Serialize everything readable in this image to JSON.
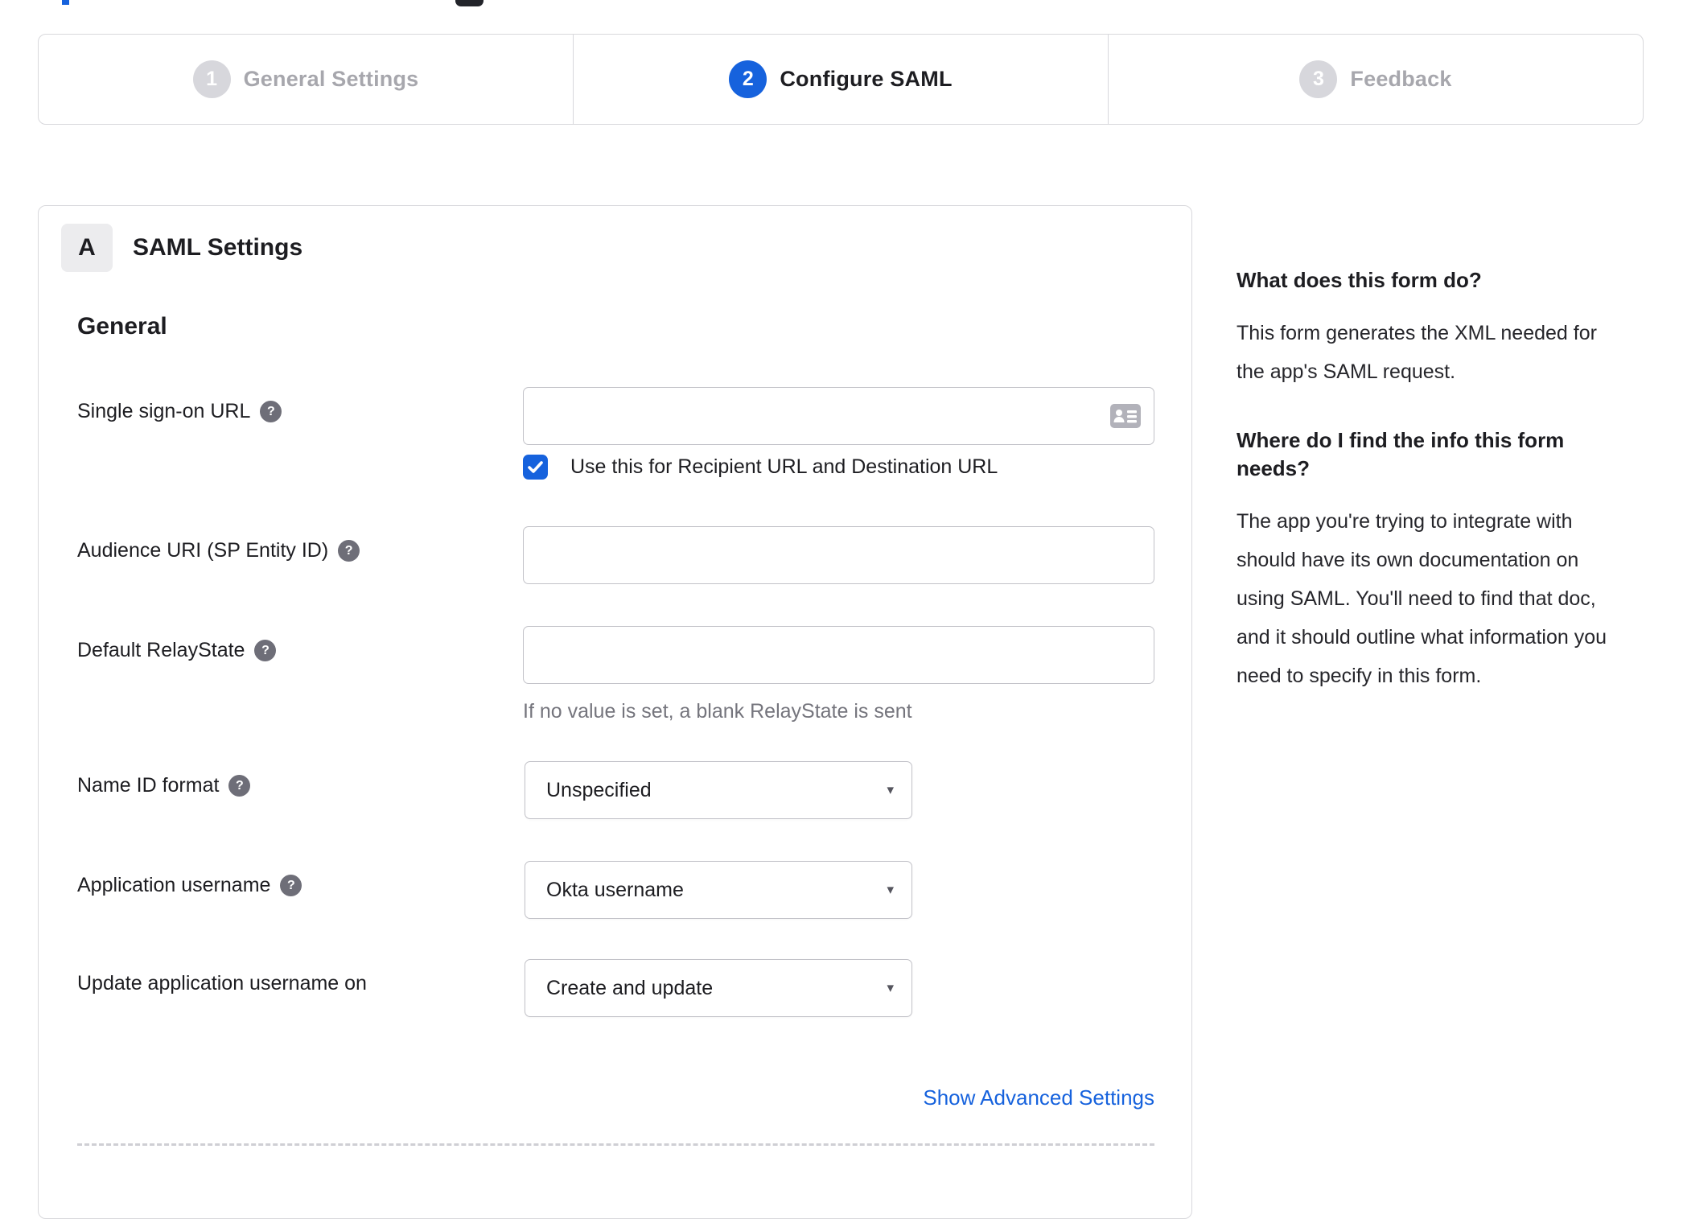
{
  "stepper": {
    "steps": [
      {
        "number": "1",
        "label": "General Settings",
        "state": "inactive"
      },
      {
        "number": "2",
        "label": "Configure SAML",
        "state": "active"
      },
      {
        "number": "3",
        "label": "Feedback",
        "state": "inactive"
      }
    ]
  },
  "form": {
    "section_badge": "A",
    "section_title": "SAML Settings",
    "group_heading": "General",
    "fields": {
      "sso_url": {
        "label": "Single sign-on URL",
        "value": "",
        "checkbox_label": "Use this for Recipient URL and Destination URL",
        "checkbox_checked": "true"
      },
      "audience_uri": {
        "label": "Audience URI (SP Entity ID)",
        "value": ""
      },
      "default_relaystate": {
        "label": "Default RelayState",
        "value": "",
        "hint": "If no value is set, a blank RelayState is sent"
      },
      "name_id_format": {
        "label": "Name ID format",
        "value": "Unspecified"
      },
      "app_username": {
        "label": "Application username",
        "value": "Okta username"
      },
      "update_app_username": {
        "label": "Update application username on",
        "value": "Create and update"
      }
    },
    "advanced_link": "Show Advanced Settings"
  },
  "sidebar": {
    "q1": "What does this form do?",
    "a1": "This form generates the XML needed for the app's SAML request.",
    "q2": "Where do I find the info this form needs?",
    "a2": "The app you're trying to integrate with should have its own documentation on using SAML. You'll need to find that doc, and it should outline what information you need to specify in this form."
  },
  "icons": {
    "help_glyph": "?",
    "dropdown_arrow": "▾"
  },
  "colors": {
    "accent": "#1662dd",
    "link": "#1662dd"
  }
}
